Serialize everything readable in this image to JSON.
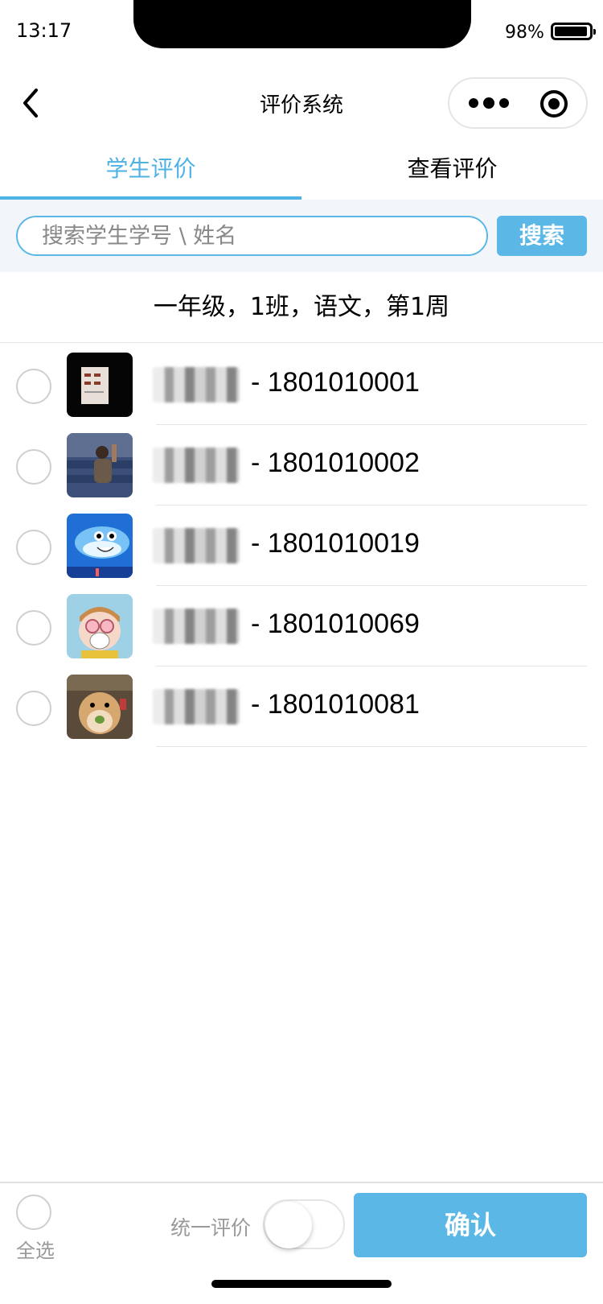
{
  "status_bar": {
    "time": "13:17",
    "battery_percent": "98%"
  },
  "nav": {
    "title": "评价系统",
    "back_icon": "chevron-left-icon",
    "more_icon": "more-dots-icon",
    "close_icon": "target-circle-icon"
  },
  "tabs": [
    {
      "label": "学生评价",
      "active": true
    },
    {
      "label": "查看评价",
      "active": false
    }
  ],
  "search": {
    "placeholder": "搜索学生学号 \\ 姓名",
    "value": "",
    "button_label": "搜索"
  },
  "class_info": "一年级，1班，语文，第1周",
  "students": [
    {
      "id_text": "- 1801010001",
      "selected": false,
      "avatar": "paper-sign-avatar"
    },
    {
      "id_text": "- 1801010002",
      "selected": false,
      "avatar": "person-in-theater-avatar"
    },
    {
      "id_text": "- 1801010019",
      "selected": false,
      "avatar": "cartoon-shark-avatar"
    },
    {
      "id_text": "- 1801010069",
      "selected": false,
      "avatar": "cartoon-boy-mask-avatar"
    },
    {
      "id_text": "- 1801010081",
      "selected": false,
      "avatar": "hamster-avatar"
    }
  ],
  "bottom": {
    "select_all_label": "全选",
    "unify_label": "统一评价",
    "unify_toggle_on": false,
    "confirm_label": "确认"
  },
  "colors": {
    "accent": "#5bb7e6",
    "tab_active": "#4fb2e4",
    "search_bg": "#f2f6fb"
  }
}
